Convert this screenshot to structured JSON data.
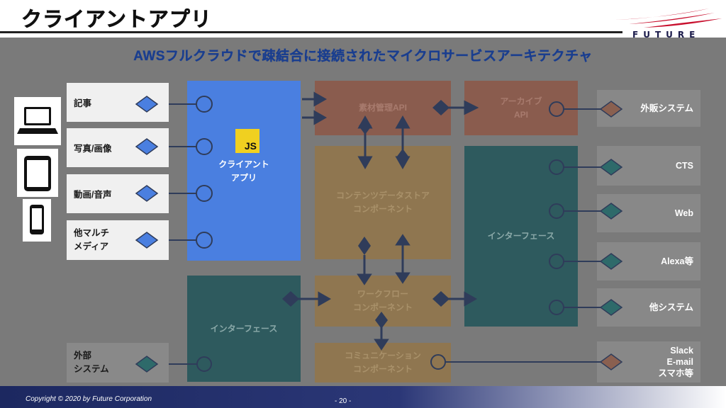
{
  "header": {
    "title": "クライアントアプリ",
    "logo_text": "FUTURE"
  },
  "diagram": {
    "subtitle": "AWSフルクラウドで疎結合に接続されたマイクロサービスアーキテクチャ",
    "sources": {
      "article": "記事",
      "photo": "写真/画像",
      "video": "動画/音声",
      "multimedia": "他マルチ\nメディア",
      "external": "外部\nシステム"
    },
    "client_app": {
      "icon_label": "JS",
      "label": "クライアント\nアプリ"
    },
    "components": {
      "material_api": "素材管理API",
      "archive_api": "アーカイブ\nAPI",
      "content_store": "コンテンツデータストア\nコンポーネント",
      "interface_right": "インターフェース",
      "workflow": "ワークフロー\nコンポーネント",
      "interface_left": "インターフェース",
      "communication": "コミュニケーション\nコンポーネント"
    },
    "externals": {
      "ext_sales": "外販システム",
      "cts": "CTS",
      "web": "Web",
      "alexa": "Alexa等",
      "other": "他システム",
      "slack": "Slack\nE-mail\nスマホ等"
    },
    "colors": {
      "client_blue": "#4a7fe0",
      "material_brown": "#8a5c4e",
      "archive_brown": "#8a5c4e",
      "component_tan": "#8f7650",
      "interface_teal": "#2e5a5e",
      "panel_gray": "#7a7a7a",
      "connector_navy": "#2f3c5a",
      "diamond_blue": "#4a7fe0",
      "diamond_teal": "#2e6a6a",
      "diamond_brown": "#8a6050"
    }
  },
  "footer": {
    "copyright": "Copyright © 2020 by Future  Corporation",
    "page": "- 20 -"
  }
}
